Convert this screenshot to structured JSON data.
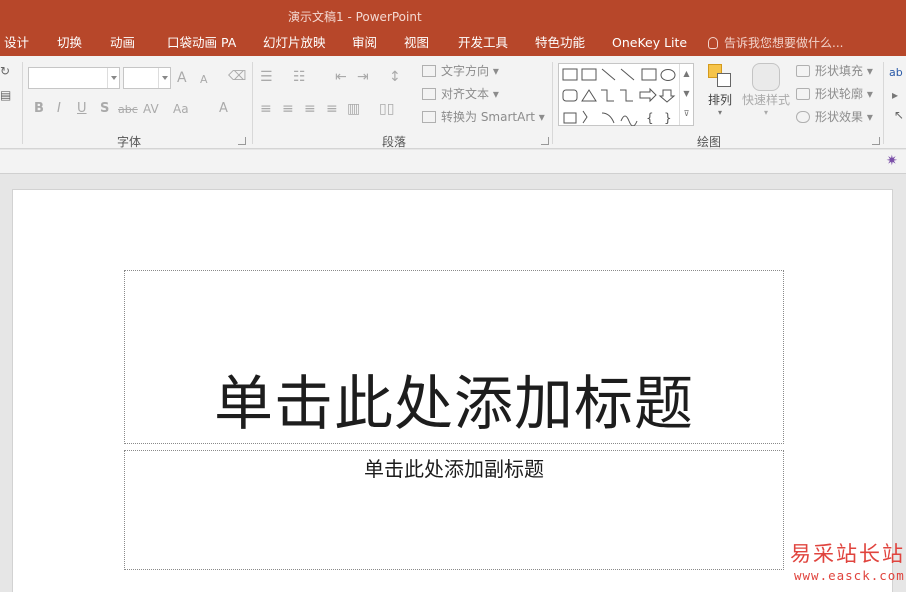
{
  "app": {
    "title": "演示文稿1 - PowerPoint",
    "accent": "#b7472a"
  },
  "tabs": [
    "设计",
    "切换",
    "动画",
    "口袋动画 PA",
    "幻灯片放映",
    "审阅",
    "视图",
    "开发工具",
    "特色功能",
    "OneKey Lite"
  ],
  "tell_me": {
    "placeholder": "告诉我您想要做什么..."
  },
  "ribbon": {
    "groups": {
      "font": "字体",
      "paragraph": "段落",
      "drawing": "绘图"
    },
    "paragraph": {
      "text_direction": "文字方向",
      "align_text": "对齐文本",
      "convert_smartart": "转换为 SmartArt"
    },
    "font": {
      "grow_font": "A",
      "shrink_font": "A",
      "bold": "B",
      "italic": "I",
      "underline": "U",
      "shadow": "S",
      "strikethrough": "abc",
      "char_spacing": "AV",
      "change_case": "Aa",
      "font_color": "A"
    },
    "drawing": {
      "arrange": "排列",
      "quick_styles": "快速样式",
      "shape_fill": "形状填充",
      "shape_outline": "形状轮廓",
      "shape_effects": "形状效果"
    }
  },
  "slide": {
    "title_placeholder": "单击此处添加标题",
    "subtitle_placeholder": "单击此处添加副标题"
  },
  "watermark": {
    "line1": "易采站长站",
    "line2": "www.easck.com"
  }
}
